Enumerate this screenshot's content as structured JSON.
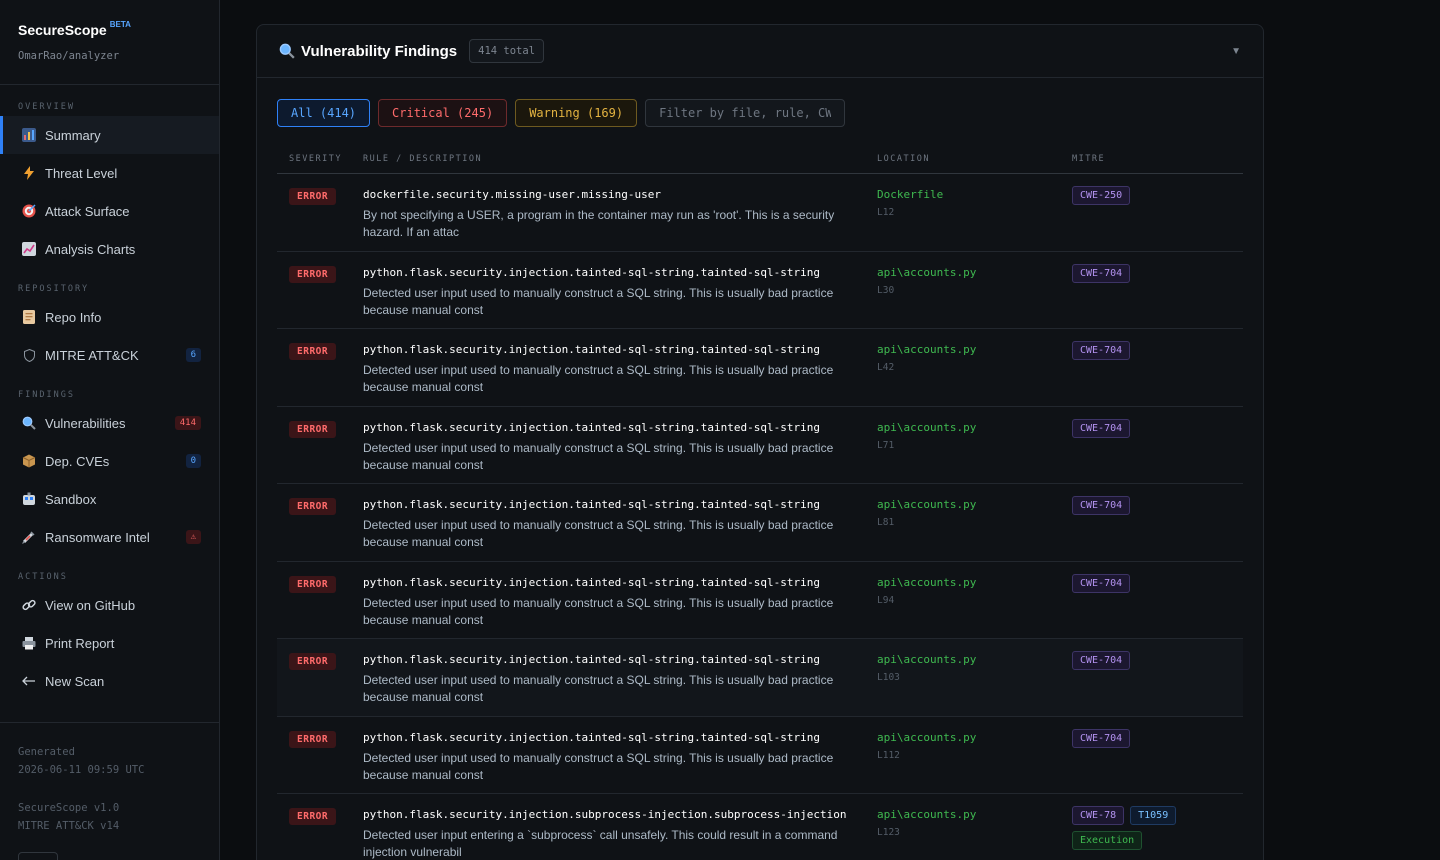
{
  "brand": {
    "name": "SecureScope",
    "beta": "BETA",
    "repo": "OmarRao/analyzer"
  },
  "sidebar": {
    "sections": {
      "overview": "OVERVIEW",
      "repository": "REPOSITORY",
      "findings": "FINDINGS",
      "actions": "ACTIONS"
    },
    "items": {
      "summary": {
        "label": "Summary",
        "icon": "bar-chart-icon"
      },
      "threat": {
        "label": "Threat Level",
        "icon": "lightning-icon"
      },
      "attack": {
        "label": "Attack Surface",
        "icon": "target-icon"
      },
      "charts": {
        "label": "Analysis Charts",
        "icon": "line-chart-icon"
      },
      "repo_info": {
        "label": "Repo Info",
        "icon": "document-icon"
      },
      "mitre": {
        "label": "MITRE ATT&CK",
        "icon": "shield-icon",
        "badge": "6"
      },
      "vulns": {
        "label": "Vulnerabilities",
        "icon": "magnifier-icon",
        "badge": "414"
      },
      "cves": {
        "label": "Dep. CVEs",
        "icon": "package-icon",
        "badge": "0"
      },
      "sandbox": {
        "label": "Sandbox",
        "icon": "container-icon"
      },
      "ransom": {
        "label": "Ransomware Intel",
        "icon": "syringe-icon",
        "badge": "⚠"
      },
      "github": {
        "label": "View on GitHub",
        "icon": "link-icon"
      },
      "print": {
        "label": "Print Report",
        "icon": "printer-icon"
      },
      "newscan": {
        "label": "New Scan",
        "icon": "arrow-left-icon"
      }
    },
    "footer": {
      "generated_label": "Generated",
      "generated_time": "2026-06-11 09:59 UTC",
      "version": "SecureScope v1.0",
      "mitre_version": "MITRE ATT&CK v14"
    }
  },
  "panel": {
    "title": "Vulnerability Findings",
    "total": "414 total",
    "filters": {
      "all": "All (414)",
      "critical": "Critical (245)",
      "warning": "Warning (169)",
      "search_placeholder": "Filter by file, rule, CWE..."
    },
    "columns": {
      "severity": "SEVERITY",
      "rule": "RULE / DESCRIPTION",
      "location": "LOCATION",
      "mitre": "MITRE"
    },
    "rows": [
      {
        "severity": "ERROR",
        "rule": "dockerfile.security.missing-user.missing-user",
        "desc": "By not specifying a USER, a program in the container may run as 'root'. This is a security hazard. If an attac",
        "file": "Dockerfile",
        "line": "L12",
        "tags": [
          "CWE-250"
        ]
      },
      {
        "severity": "ERROR",
        "rule": "python.flask.security.injection.tainted-sql-string.tainted-sql-string",
        "desc": "Detected user input used to manually construct a SQL string. This is usually bad practice because manual const",
        "file": "api\\accounts.py",
        "line": "L30",
        "tags": [
          "CWE-704"
        ]
      },
      {
        "severity": "ERROR",
        "rule": "python.flask.security.injection.tainted-sql-string.tainted-sql-string",
        "desc": "Detected user input used to manually construct a SQL string. This is usually bad practice because manual const",
        "file": "api\\accounts.py",
        "line": "L42",
        "tags": [
          "CWE-704"
        ]
      },
      {
        "severity": "ERROR",
        "rule": "python.flask.security.injection.tainted-sql-string.tainted-sql-string",
        "desc": "Detected user input used to manually construct a SQL string. This is usually bad practice because manual const",
        "file": "api\\accounts.py",
        "line": "L71",
        "tags": [
          "CWE-704"
        ]
      },
      {
        "severity": "ERROR",
        "rule": "python.flask.security.injection.tainted-sql-string.tainted-sql-string",
        "desc": "Detected user input used to manually construct a SQL string. This is usually bad practice because manual const",
        "file": "api\\accounts.py",
        "line": "L81",
        "tags": [
          "CWE-704"
        ]
      },
      {
        "severity": "ERROR",
        "rule": "python.flask.security.injection.tainted-sql-string.tainted-sql-string",
        "desc": "Detected user input used to manually construct a SQL string. This is usually bad practice because manual const",
        "file": "api\\accounts.py",
        "line": "L94",
        "tags": [
          "CWE-704"
        ]
      },
      {
        "severity": "ERROR",
        "rule": "python.flask.security.injection.tainted-sql-string.tainted-sql-string",
        "desc": "Detected user input used to manually construct a SQL string. This is usually bad practice because manual const",
        "file": "api\\accounts.py",
        "line": "L103",
        "tags": [
          "CWE-704"
        ]
      },
      {
        "severity": "ERROR",
        "rule": "python.flask.security.injection.tainted-sql-string.tainted-sql-string",
        "desc": "Detected user input used to manually construct a SQL string. This is usually bad practice because manual const",
        "file": "api\\accounts.py",
        "line": "L112",
        "tags": [
          "CWE-704"
        ]
      },
      {
        "severity": "ERROR",
        "rule": "python.flask.security.injection.subprocess-injection.subprocess-injection",
        "desc": "Detected user input entering a `subprocess` call unsafely. This could result in a command injection vulnerabil",
        "file": "api\\accounts.py",
        "line": "L123",
        "tags": [
          "CWE-78",
          "T1059",
          "Execution"
        ]
      }
    ]
  },
  "colors": {
    "accent": "#2f81f7",
    "error": "#ff6b6b",
    "warning": "#e3b341",
    "file": "#3fb950",
    "cwe": "#b392f0"
  }
}
